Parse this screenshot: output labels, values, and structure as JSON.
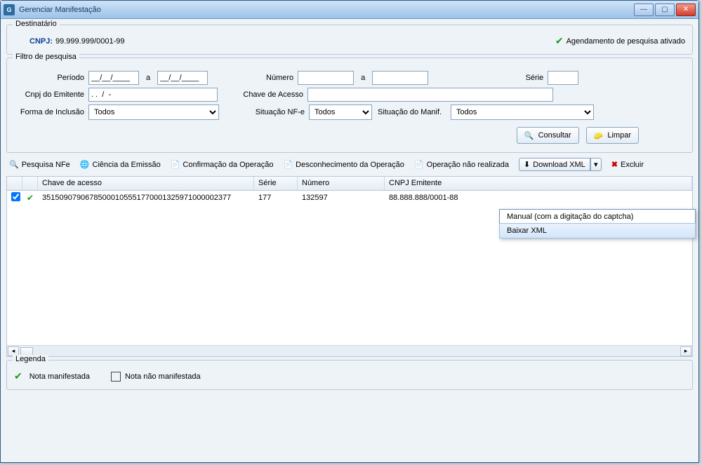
{
  "window": {
    "title": "Gerenciar Manifestação"
  },
  "destinatario": {
    "group_title": "Destinatário",
    "cnpj_label": "CNPJ:",
    "cnpj_value": "99.999.999/0001-99",
    "schedule_label": "Agendamento de pesquisa ativado"
  },
  "filtro": {
    "group_title": "Filtro de pesquisa",
    "periodo_label": "Período",
    "periodo_de": "__/__/____",
    "periodo_a_label": "a",
    "periodo_ate": "__/__/____",
    "numero_label": "Número",
    "numero_de": "",
    "numero_a_label": "a",
    "numero_ate": "",
    "serie_label": "Série",
    "serie": "",
    "cnpj_emitente_label": "Cnpj do Emitente",
    "cnpj_emitente": ". .  /  -",
    "chave_label": "Chave de Acesso",
    "chave": "",
    "forma_label": "Forma de Inclusão",
    "forma_value": "Todos",
    "situacao_nfe_label": "Situação NF-e",
    "situacao_nfe_value": "Todos",
    "situacao_manif_label": "Situação do Manif.",
    "situacao_manif_value": "Todos",
    "consultar_label": "Consultar",
    "limpar_label": "Limpar"
  },
  "toolbar": {
    "pesquisa_nfe": "Pesquisa NFe",
    "ciencia": "Ciência da Emissão",
    "confirmacao": "Confirmação da Operação",
    "desconhecimento": "Desconhecimento da Operação",
    "nao_realizada": "Operação não realizada",
    "download_xml": "Download XML",
    "excluir": "Excluir"
  },
  "download_menu": {
    "manual": "Manual (com a digitação do captcha)",
    "baixar": "Baixar XML"
  },
  "grid": {
    "columns": {
      "check": "",
      "status": "",
      "chave": "Chave de acesso",
      "serie": "Série",
      "numero": "Número",
      "cnpj_emitente": "CNPJ Emitente"
    },
    "rows": [
      {
        "checked": true,
        "chave": "35150907906785000105551770001325971000002377",
        "serie": "177",
        "numero": "132597",
        "cnpj_emitente": "88.888.888/0001-88"
      }
    ]
  },
  "legenda": {
    "group_title": "Legenda",
    "manifestada": "Nota manifestada",
    "nao_manifestada": "Nota não manifestada"
  }
}
